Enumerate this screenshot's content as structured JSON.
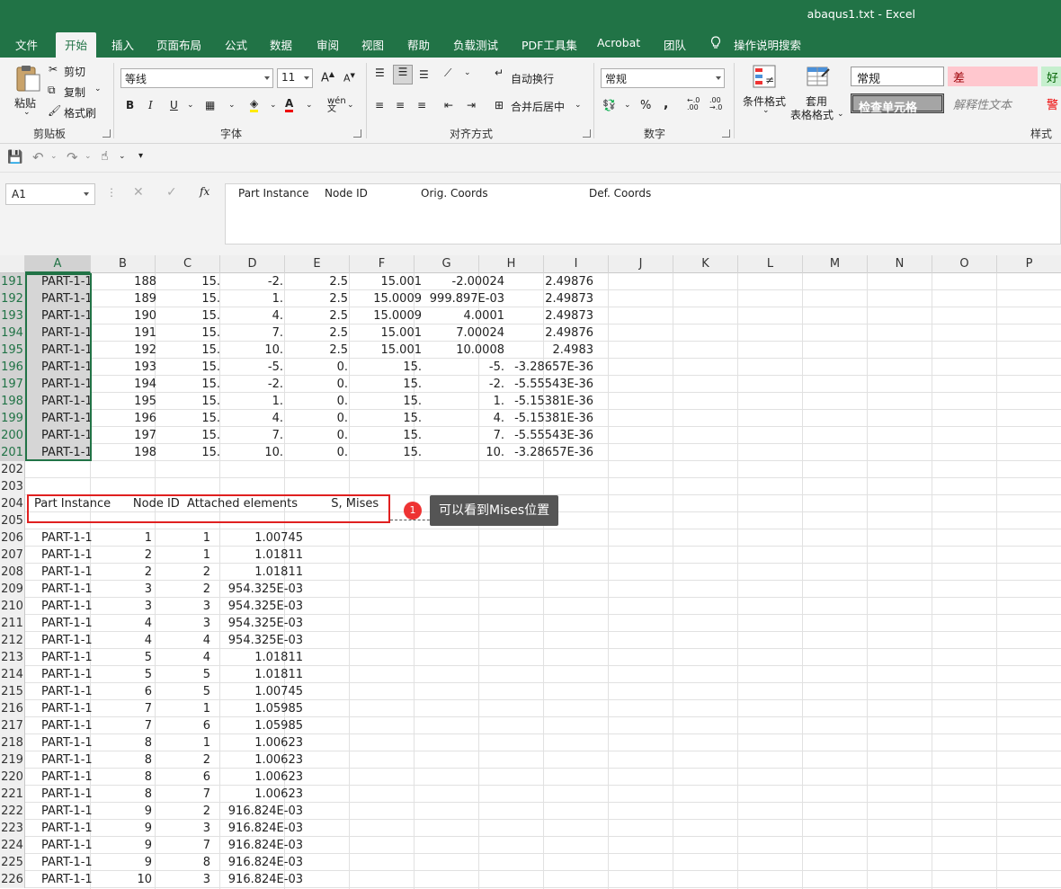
{
  "window": {
    "title": "abaqus1.txt  -  Excel"
  },
  "tabs": [
    "文件",
    "开始",
    "插入",
    "页面布局",
    "公式",
    "数据",
    "审阅",
    "视图",
    "帮助",
    "负载测试",
    "PDF工具集",
    "Acrobat",
    "团队"
  ],
  "tab_search": "操作说明搜索",
  "ribbon": {
    "clipboard": {
      "paste": "粘贴",
      "cut": "剪切",
      "copy": "复制",
      "format_painter": "格式刷",
      "group": "剪贴板"
    },
    "font": {
      "name": "等线",
      "size": "11",
      "bold": "B",
      "italic": "I",
      "underline": "U",
      "group": "字体"
    },
    "alignment": {
      "wrap": "自动换行",
      "merge": "合并后居中",
      "group": "对齐方式"
    },
    "number": {
      "format": "常规",
      "percent": "%",
      "comma": ",",
      "group": "数字"
    },
    "styles": {
      "conditional": "条件格式",
      "table_format_1": "套用",
      "table_format_2": "表格格式",
      "normal": "常规",
      "bad": "差",
      "good": "好",
      "check_cell": "检查单元格",
      "explanatory": "解释性文本",
      "warning": "警",
      "group": "样式"
    }
  },
  "formula_bar": {
    "name_box": "A1",
    "fx": "fx",
    "content": [
      "Part Instance",
      "Node ID",
      "Orig. Coords",
      "Def. Coords"
    ]
  },
  "columns": [
    "A",
    "B",
    "C",
    "D",
    "E",
    "F",
    "G",
    "H",
    "I",
    "J",
    "K",
    "L",
    "M",
    "N",
    "O",
    "P"
  ],
  "rows_top": [
    {
      "n": "191",
      "a": "PART-1-1",
      "b": "188",
      "c": "15.",
      "d": "-2.",
      "e": "2.5",
      "f": "15.001",
      "g": "-2.00024",
      "h": "2.49876"
    },
    {
      "n": "192",
      "a": "PART-1-1",
      "b": "189",
      "c": "15.",
      "d": "1.",
      "e": "2.5",
      "f": "15.0009",
      "g": "999.897E-03",
      "h": "2.49873"
    },
    {
      "n": "193",
      "a": "PART-1-1",
      "b": "190",
      "c": "15.",
      "d": "4.",
      "e": "2.5",
      "f": "15.0009",
      "g": "4.0001",
      "h": "2.49873"
    },
    {
      "n": "194",
      "a": "PART-1-1",
      "b": "191",
      "c": "15.",
      "d": "7.",
      "e": "2.5",
      "f": "15.001",
      "g": "7.00024",
      "h": "2.49876"
    },
    {
      "n": "195",
      "a": "PART-1-1",
      "b": "192",
      "c": "15.",
      "d": "10.",
      "e": "2.5",
      "f": "15.001",
      "g": "10.0008",
      "h": "2.4983"
    },
    {
      "n": "196",
      "a": "PART-1-1",
      "b": "193",
      "c": "15.",
      "d": "-5.",
      "e": "0.",
      "f": "15.",
      "g": "-5.",
      "h": "-3.28657E-36"
    },
    {
      "n": "197",
      "a": "PART-1-1",
      "b": "194",
      "c": "15.",
      "d": "-2.",
      "e": "0.",
      "f": "15.",
      "g": "-2.",
      "h": "-5.55543E-36"
    },
    {
      "n": "198",
      "a": "PART-1-1",
      "b": "195",
      "c": "15.",
      "d": "1.",
      "e": "0.",
      "f": "15.",
      "g": "1.",
      "h": "-5.15381E-36"
    },
    {
      "n": "199",
      "a": "PART-1-1",
      "b": "196",
      "c": "15.",
      "d": "4.",
      "e": "0.",
      "f": "15.",
      "g": "4.",
      "h": "-5.15381E-36"
    },
    {
      "n": "200",
      "a": "PART-1-1",
      "b": "197",
      "c": "15.",
      "d": "7.",
      "e": "0.",
      "f": "15.",
      "g": "7.",
      "h": "-5.55543E-36"
    },
    {
      "n": "201",
      "a": "PART-1-1",
      "b": "198",
      "c": "15.",
      "d": "10.",
      "e": "0.",
      "f": "15.",
      "g": "10.",
      "h": "-3.28657E-36"
    }
  ],
  "blank_rows": [
    "202",
    "203"
  ],
  "header_row": {
    "n": "204",
    "text": "Part Instance      Node ID  Attached elements         S, Mises"
  },
  "row_205": "205",
  "rows_bottom": [
    {
      "n": "206",
      "a": "PART-1-1",
      "b": "1",
      "c": "1",
      "d": "1.00745"
    },
    {
      "n": "207",
      "a": "PART-1-1",
      "b": "2",
      "c": "1",
      "d": "1.01811"
    },
    {
      "n": "208",
      "a": "PART-1-1",
      "b": "2",
      "c": "2",
      "d": "1.01811"
    },
    {
      "n": "209",
      "a": "PART-1-1",
      "b": "3",
      "c": "2",
      "d": "954.325E-03"
    },
    {
      "n": "210",
      "a": "PART-1-1",
      "b": "3",
      "c": "3",
      "d": "954.325E-03"
    },
    {
      "n": "211",
      "a": "PART-1-1",
      "b": "4",
      "c": "3",
      "d": "954.325E-03"
    },
    {
      "n": "212",
      "a": "PART-1-1",
      "b": "4",
      "c": "4",
      "d": "954.325E-03"
    },
    {
      "n": "213",
      "a": "PART-1-1",
      "b": "5",
      "c": "4",
      "d": "1.01811"
    },
    {
      "n": "214",
      "a": "PART-1-1",
      "b": "5",
      "c": "5",
      "d": "1.01811"
    },
    {
      "n": "215",
      "a": "PART-1-1",
      "b": "6",
      "c": "5",
      "d": "1.00745"
    },
    {
      "n": "216",
      "a": "PART-1-1",
      "b": "7",
      "c": "1",
      "d": "1.05985"
    },
    {
      "n": "217",
      "a": "PART-1-1",
      "b": "7",
      "c": "6",
      "d": "1.05985"
    },
    {
      "n": "218",
      "a": "PART-1-1",
      "b": "8",
      "c": "1",
      "d": "1.00623"
    },
    {
      "n": "219",
      "a": "PART-1-1",
      "b": "8",
      "c": "2",
      "d": "1.00623"
    },
    {
      "n": "220",
      "a": "PART-1-1",
      "b": "8",
      "c": "6",
      "d": "1.00623"
    },
    {
      "n": "221",
      "a": "PART-1-1",
      "b": "8",
      "c": "7",
      "d": "1.00623"
    },
    {
      "n": "222",
      "a": "PART-1-1",
      "b": "9",
      "c": "2",
      "d": "916.824E-03"
    },
    {
      "n": "223",
      "a": "PART-1-1",
      "b": "9",
      "c": "3",
      "d": "916.824E-03"
    },
    {
      "n": "224",
      "a": "PART-1-1",
      "b": "9",
      "c": "7",
      "d": "916.824E-03"
    },
    {
      "n": "225",
      "a": "PART-1-1",
      "b": "9",
      "c": "8",
      "d": "916.824E-03"
    },
    {
      "n": "226",
      "a": "PART-1-1",
      "b": "10",
      "c": "3",
      "d": "916.824E-03"
    }
  ],
  "annotation": {
    "number": "1",
    "text": "可以看到Mises位置"
  },
  "colors": {
    "excel_green": "#217346",
    "highlight_red": "#e02020",
    "bad_fill": "#ffc7ce",
    "good_fill": "#c6efce"
  }
}
